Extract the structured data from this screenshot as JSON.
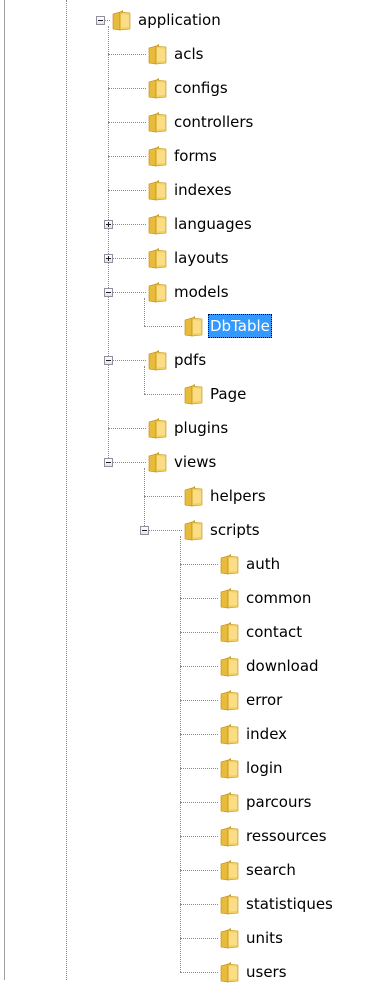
{
  "colors": {
    "selection_background": "#3399ff",
    "selection_text": "#ffffff",
    "folder": "#e8bc3a",
    "connector_lines": "#8a8a8a"
  },
  "tree": {
    "nodes": [
      {
        "label": "application",
        "depth": 0,
        "expander": "expanded",
        "selected": false,
        "icon": "folder-icon"
      },
      {
        "label": "acls",
        "depth": 1,
        "expander": "none",
        "selected": false,
        "icon": "folder-icon"
      },
      {
        "label": "configs",
        "depth": 1,
        "expander": "none",
        "selected": false,
        "icon": "folder-icon"
      },
      {
        "label": "controllers",
        "depth": 1,
        "expander": "none",
        "selected": false,
        "icon": "folder-icon"
      },
      {
        "label": "forms",
        "depth": 1,
        "expander": "none",
        "selected": false,
        "icon": "folder-icon"
      },
      {
        "label": "indexes",
        "depth": 1,
        "expander": "none",
        "selected": false,
        "icon": "folder-icon"
      },
      {
        "label": "languages",
        "depth": 1,
        "expander": "collapsed",
        "selected": false,
        "icon": "folder-icon"
      },
      {
        "label": "layouts",
        "depth": 1,
        "expander": "collapsed",
        "selected": false,
        "icon": "folder-icon"
      },
      {
        "label": "models",
        "depth": 1,
        "expander": "expanded",
        "selected": false,
        "icon": "folder-icon"
      },
      {
        "label": "DbTable",
        "depth": 2,
        "expander": "none",
        "selected": true,
        "icon": "folder-icon"
      },
      {
        "label": "pdfs",
        "depth": 1,
        "expander": "expanded",
        "selected": false,
        "icon": "folder-icon"
      },
      {
        "label": "Page",
        "depth": 2,
        "expander": "none",
        "selected": false,
        "icon": "folder-icon"
      },
      {
        "label": "plugins",
        "depth": 1,
        "expander": "none",
        "selected": false,
        "icon": "folder-icon"
      },
      {
        "label": "views",
        "depth": 1,
        "expander": "expanded",
        "selected": false,
        "icon": "folder-icon"
      },
      {
        "label": "helpers",
        "depth": 2,
        "expander": "none",
        "selected": false,
        "icon": "folder-icon"
      },
      {
        "label": "scripts",
        "depth": 2,
        "expander": "expanded",
        "selected": false,
        "icon": "folder-icon"
      },
      {
        "label": "auth",
        "depth": 3,
        "expander": "none",
        "selected": false,
        "icon": "folder-icon"
      },
      {
        "label": "common",
        "depth": 3,
        "expander": "none",
        "selected": false,
        "icon": "folder-icon"
      },
      {
        "label": "contact",
        "depth": 3,
        "expander": "none",
        "selected": false,
        "icon": "folder-icon"
      },
      {
        "label": "download",
        "depth": 3,
        "expander": "none",
        "selected": false,
        "icon": "folder-icon"
      },
      {
        "label": "error",
        "depth": 3,
        "expander": "none",
        "selected": false,
        "icon": "folder-icon"
      },
      {
        "label": "index",
        "depth": 3,
        "expander": "none",
        "selected": false,
        "icon": "folder-icon"
      },
      {
        "label": "login",
        "depth": 3,
        "expander": "none",
        "selected": false,
        "icon": "folder-icon"
      },
      {
        "label": "parcours",
        "depth": 3,
        "expander": "none",
        "selected": false,
        "icon": "folder-icon"
      },
      {
        "label": "ressources",
        "depth": 3,
        "expander": "none",
        "selected": false,
        "icon": "folder-icon"
      },
      {
        "label": "search",
        "depth": 3,
        "expander": "none",
        "selected": false,
        "icon": "folder-icon"
      },
      {
        "label": "statistiques",
        "depth": 3,
        "expander": "none",
        "selected": false,
        "icon": "folder-icon"
      },
      {
        "label": "units",
        "depth": 3,
        "expander": "none",
        "selected": false,
        "icon": "folder-icon"
      },
      {
        "label": "users",
        "depth": 3,
        "expander": "none",
        "selected": false,
        "icon": "folder-icon"
      }
    ]
  }
}
